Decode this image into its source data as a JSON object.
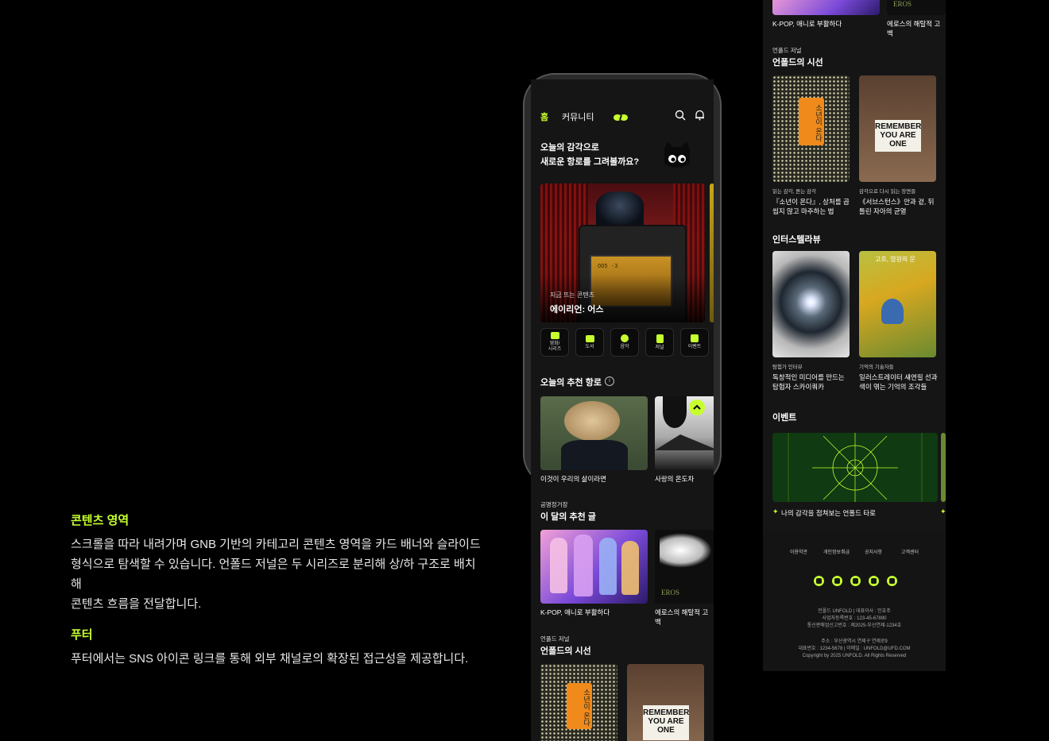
{
  "left": {
    "content_title": "콘텐츠 영역",
    "content_lines": [
      "스크롤을 따라 내려가며 GNB 기반의 카테고리 콘텐츠 영역을 카드 배너와 슬라이드",
      "형식으로 탐색할 수 있습니다. 언폴드 저널은 두 시리즈로 분리해 상/하 구조로 배치해",
      "콘텐츠 흐름을 전달합니다."
    ],
    "footer_title": "푸터",
    "footer_text": "푸터에서는 SNS 아이콘 링크를 통해 외부 채널로의 확장된 접근성을 제공합니다."
  },
  "phone": {
    "nav": {
      "home": "홈",
      "community": "커뮤니티"
    },
    "greeting_line1": "오늘의 감각으로",
    "greeting_line2": "새로운 항로를 그려볼까요?",
    "banner": {
      "kicker": "지금 뜨는 콘텐츠",
      "title": "에이리언: 어스",
      "door_text": "OO5 -3"
    },
    "categories": [
      {
        "label": "영화/\n시리즈",
        "icon": "clapper-icon"
      },
      {
        "label": "도서",
        "icon": "book-icon"
      },
      {
        "label": "음악",
        "icon": "music-icon"
      },
      {
        "label": "저널",
        "icon": "journal-icon"
      },
      {
        "label": "이벤트",
        "icon": "event-icon"
      }
    ],
    "recommend_title": "오늘의 추천 항로",
    "recommend_items": [
      "이것이 우리의 삶이라면",
      "사랑의 온도차"
    ],
    "monthly_kicker": "공명정거장",
    "monthly_title": "이 달의 추천 글",
    "monthly_items": [
      "K-POP, 애니로 부활하다",
      "에로스의 해탈적 고백"
    ],
    "journal_kicker": "언폴드 저널",
    "journal_title": "언폴드의 시선",
    "book1_text": "소년이 온다",
    "book2_text": "REMEMBER YOU ARE ONE"
  },
  "panel": {
    "top_items": [
      "K-POP, 애니로 부활하다",
      "에로스의 해탈적 고백"
    ],
    "eros_text": "EROS",
    "journal_kicker": "언폴드 저널",
    "journal_title": "언폴드의 시선",
    "journal_items": [
      {
        "kicker": "읽는 감각, 듣는 감각",
        "title": "『소년이 온다』, 상처를 곱씹지 않고 마주하는 법"
      },
      {
        "kicker": "감각으로 다시 읽는 장면들",
        "title": "《서브스턴스》안과 겉, 뒤틀린 자아의 균열"
      }
    ],
    "interstellar_title": "인터스텔라뷰",
    "interview_items": [
      {
        "kicker": "탐험가 인터뷰",
        "title": "독창적인 미디어를 만드는 탐험자 스카이쿼카"
      },
      {
        "kicker": "기억의 기술자들",
        "title": "일러스트레이터 섀연필 선과 색이 엮는 기억의 조각들"
      }
    ],
    "painting_text": "고흐, 영원의 문",
    "event_title": "이벤트",
    "event_caption": "나의 감각을 점쳐보는 언폴드 타로",
    "footer_links": [
      "이용약관",
      "개인정보취급",
      "공지사항",
      "고객센터"
    ],
    "sns": [
      "instagram-icon",
      "x-icon",
      "youtube-icon",
      "play-icon",
      "apple-icon"
    ],
    "info_lines": [
      "언폴드 UNFOLD | 대표이사 : 인호주",
      "사업자등록번호 : 123-45-67890",
      "통신판매업신고번호 : 제2025-부산연제-1234호"
    ],
    "info_lines2": [
      "주소 : 부산광역시 연제구 연제로9",
      "대표번호 : 1234-5678 | 이메일 : UNFOLD@UFD.COM",
      "Copyright by 2025 UNFOLD. All Rights Reserved"
    ]
  },
  "colors": {
    "accent": "#c6ff2e",
    "background": "#000000",
    "surface": "#151515"
  }
}
